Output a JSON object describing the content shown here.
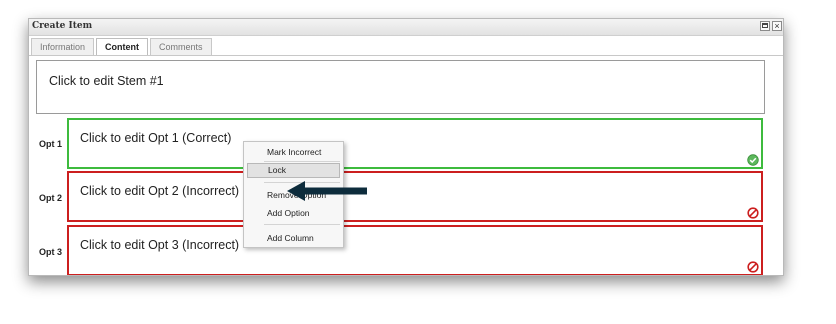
{
  "window": {
    "title": "Create Item"
  },
  "tabs": [
    {
      "label": "Information",
      "active": false
    },
    {
      "label": "Content",
      "active": true
    },
    {
      "label": "Comments",
      "active": false
    }
  ],
  "stem": {
    "text": "Click to edit Stem #1"
  },
  "options": [
    {
      "label": "Opt 1",
      "text": "Click to edit Opt 1 (Correct)",
      "status": "correct",
      "status_icon": "check-circle-icon",
      "border_color": "#3dbb3d"
    },
    {
      "label": "Opt 2",
      "text": "Click to edit Opt 2 (Incorrect)",
      "status": "incorrect",
      "status_icon": "prohibited-icon",
      "border_color": "#cc1f1f"
    },
    {
      "label": "Opt 3",
      "text": "Click to edit Opt 3 (Incorrect)",
      "status": "incorrect",
      "status_icon": "prohibited-icon",
      "border_color": "#cc1f1f"
    }
  ],
  "context_menu": {
    "items": [
      "Mark Incorrect",
      "Lock",
      "Remove Option",
      "Add Option",
      "Add Column"
    ],
    "hovered": "Lock"
  },
  "colors": {
    "correct": "#3dbb3d",
    "incorrect": "#cc1f1f",
    "arrow": "#0d2c3c"
  }
}
